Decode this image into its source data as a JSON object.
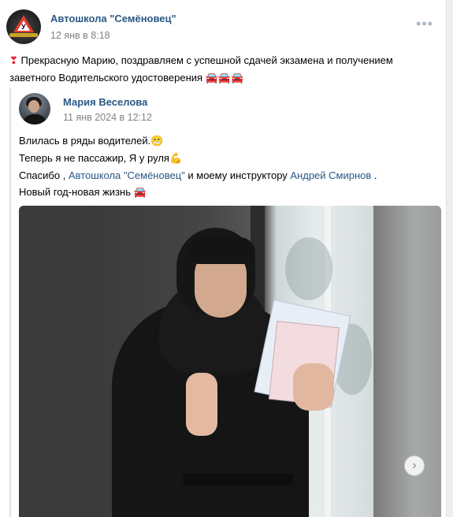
{
  "post": {
    "author": "Автошкола \"Семёновец\"",
    "time": "12 янв в 8:18",
    "more_icon": "more-dots-icon",
    "text_line1_prefix": "❣",
    "text_line1": "Прекрасную Марию, поздравляем с успешной сдачей экзамена и получением",
    "text_line2": "заветного Водительского удостоверения",
    "text_line2_emoji": "🚘🚘🚘"
  },
  "repost": {
    "author": "Мария Веселова",
    "time": "11 янв 2024 в 12:12",
    "line1": "Влилась в ряды водителей.",
    "line1_emoji": "😬",
    "line2": "Теперь я не пассажир, Я у руля",
    "line2_emoji": "💪",
    "line3_a": "Спасибо , ",
    "line3_link1": "Автошкола \"Семёновец\"",
    "line3_b": " и моему инструктору ",
    "line3_link2": "Андрей Смирнов",
    "line3_c": " .",
    "line4": "Новый год-новая жизнь",
    "line4_emoji": "🚘"
  },
  "gallery": {
    "next_label": "›"
  },
  "colors": {
    "link": "#2a5885",
    "muted": "#828282",
    "border": "#dce1e6"
  }
}
